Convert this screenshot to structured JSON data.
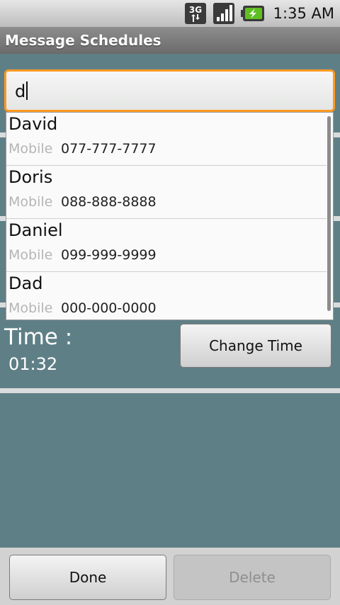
{
  "status_bar": {
    "network_label": "3G",
    "time": "1:35 AM",
    "icons": [
      "3g-data-icon",
      "signal-icon",
      "battery-charging-icon"
    ]
  },
  "title_bar": {
    "title": "Message Schedules"
  },
  "search": {
    "value": "d"
  },
  "suggestions": [
    {
      "name": "David",
      "type": "Mobile",
      "number": "077-777-7777"
    },
    {
      "name": "Doris",
      "type": "Mobile",
      "number": "088-888-8888"
    },
    {
      "name": "Daniel",
      "type": "Mobile",
      "number": "099-999-9999"
    },
    {
      "name": "Dad",
      "type": "Mobile",
      "number": "000-000-0000"
    }
  ],
  "time_section": {
    "label": "Time :",
    "value": "01:32",
    "change_button": "Change Time"
  },
  "bottom_bar": {
    "done_label": "Done",
    "delete_label": "Delete"
  },
  "colors": {
    "background": "#5f7f86",
    "focus_border": "#ff9a22",
    "battery_green": "#5fbf1f"
  }
}
